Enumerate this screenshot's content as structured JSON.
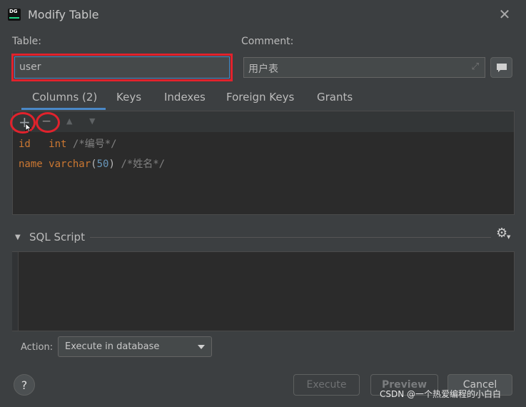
{
  "window": {
    "title": "Modify Table",
    "app_icon_text": "DG"
  },
  "form": {
    "table_label": "Table:",
    "table_value": "user",
    "comment_label": "Comment:",
    "comment_value": "用户表"
  },
  "tabs": [
    {
      "label": "Columns (2)",
      "selected": true
    },
    {
      "label": "Keys"
    },
    {
      "label": "Indexes"
    },
    {
      "label": "Foreign Keys"
    },
    {
      "label": "Grants"
    }
  ],
  "toolbar": {
    "add": "+",
    "remove": "−",
    "move_up": "▲",
    "move_down": "▼"
  },
  "columns": [
    {
      "name": "id",
      "type": "int",
      "size": "",
      "comment": "/*编号*/"
    },
    {
      "name": "name",
      "type": "varchar",
      "size": "50",
      "comment": "/*姓名*/"
    }
  ],
  "sql_script": {
    "label": "SQL Script"
  },
  "action": {
    "label": "Action:",
    "selected": "Execute in database"
  },
  "buttons": {
    "help": "?",
    "execute": "Execute",
    "preview": "Preview",
    "cancel": "Cancel"
  },
  "watermark": "CSDN @一个热爱编程的小白白",
  "colors": {
    "keyword": "#cc7832",
    "comment": "#808080",
    "number": "#6897bb",
    "highlight": "#e1222c",
    "accent": "#4a88c7"
  }
}
